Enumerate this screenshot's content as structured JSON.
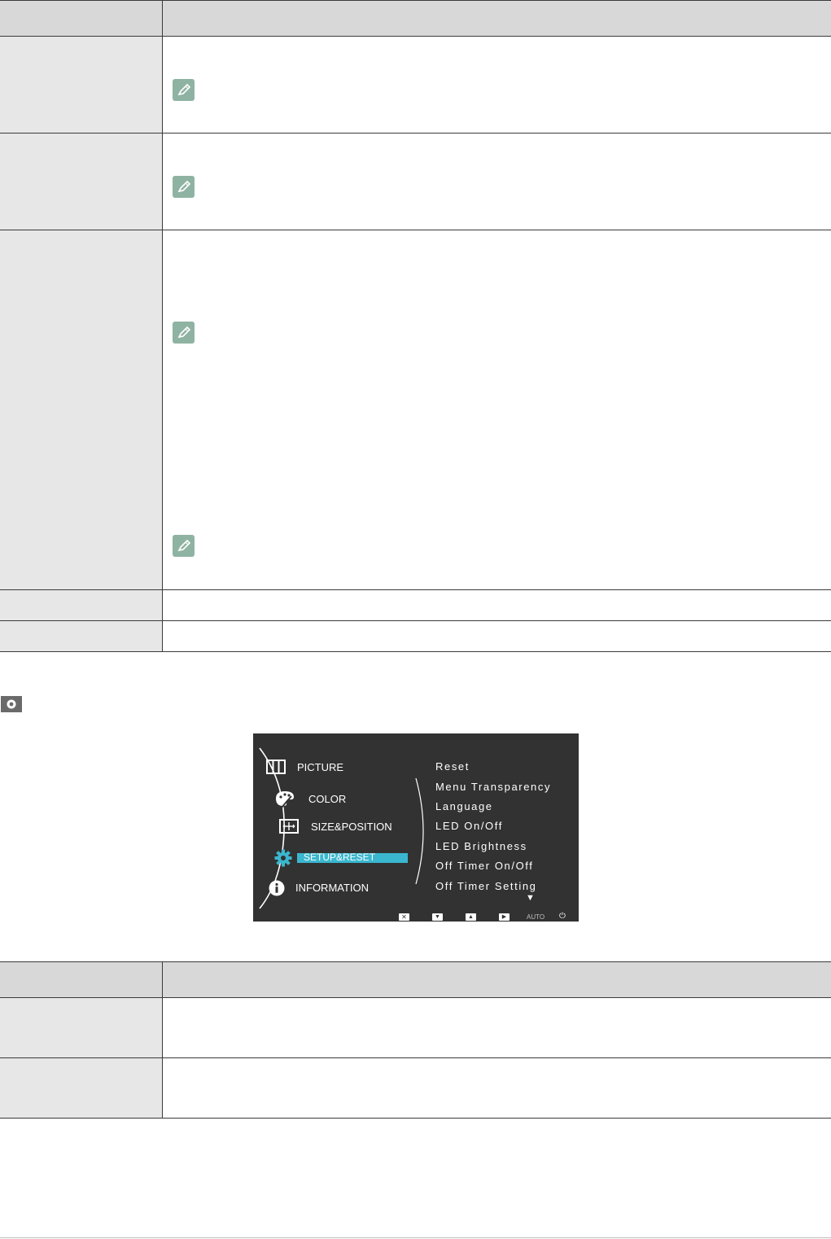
{
  "osd_menu": {
    "left_items": [
      {
        "label": "PICTURE",
        "icon": "picture-icon"
      },
      {
        "label": "COLOR",
        "icon": "palette-icon"
      },
      {
        "label": "SIZE&POSITION",
        "icon": "size-position-icon"
      },
      {
        "label": "SETUP&RESET",
        "icon": "gear-icon",
        "selected": true
      },
      {
        "label": "INFORMATION",
        "icon": "info-icon"
      }
    ],
    "right_items": [
      "Reset",
      "Menu Transparency",
      "Language",
      "LED On/Off",
      "LED Brightness",
      "Off Timer On/Off",
      "Off Timer Setting"
    ],
    "more_indicator": "▼",
    "bottom_buttons": [
      {
        "icon": "close-icon",
        "glyph": "✕"
      },
      {
        "icon": "down-arrow-icon",
        "glyph": "▼"
      },
      {
        "icon": "up-arrow-icon",
        "glyph": "▲"
      },
      {
        "icon": "right-arrow-icon",
        "glyph": "▶"
      },
      {
        "icon": "auto-label",
        "label": "AUTO"
      },
      {
        "icon": "power-icon",
        "glyph": "⏻"
      }
    ],
    "highlight_color": "#3ab7cf",
    "background_color": "#323232"
  },
  "note_icon": "pencil-note-icon",
  "section_icon": "setup-gear-icon"
}
